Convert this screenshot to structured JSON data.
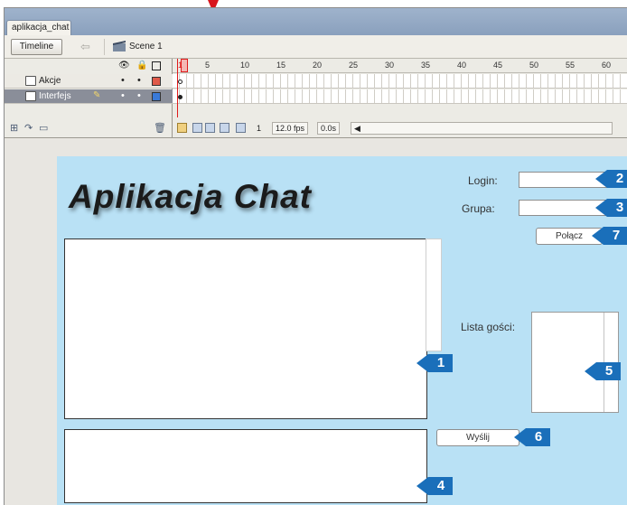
{
  "document_tab": {
    "title": "aplikacja_chat"
  },
  "toolbar": {
    "timeline_button": "Timeline",
    "scene_label": "Scene 1"
  },
  "timeline": {
    "ruler_numbers": [
      "1",
      "5",
      "10",
      "15",
      "20",
      "25",
      "30",
      "35",
      "40",
      "45",
      "50",
      "55",
      "60"
    ],
    "layers": [
      {
        "name": "Akcje",
        "color": "#e05a4a",
        "selected": false
      },
      {
        "name": "Interfejs",
        "color": "#3a7ad8",
        "selected": true
      }
    ],
    "status": {
      "current_frame": "1",
      "fps": "12.0 fps",
      "time": "0.0s"
    }
  },
  "stage": {
    "title": "Aplikacja Chat",
    "login_label": "Login:",
    "group_label": "Grupa:",
    "connect_button": "Połącz",
    "guest_list_label": "Lista gości:",
    "send_button": "Wyślij",
    "background": "#b9e1f5"
  },
  "callouts": {
    "login_field": "2",
    "group_field": "3",
    "connect_button": "7",
    "chat_area": "1",
    "guest_list": "5",
    "send_button": "6",
    "message_area": "4",
    "color": "#1a6fba"
  }
}
